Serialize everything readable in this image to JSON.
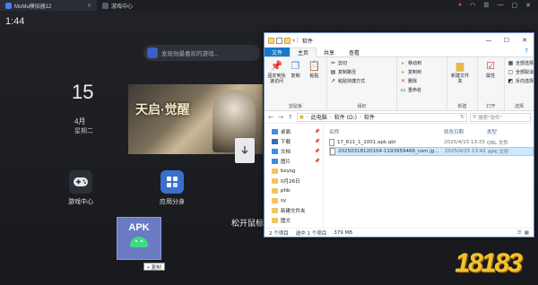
{
  "emulator": {
    "tabs": [
      {
        "label": "MuMu模拟器12"
      },
      {
        "label": "游戏中心"
      }
    ],
    "right_icons": [
      "notification-dot-icon",
      "wifi-icon",
      "menu-icon",
      "minimize-icon",
      "maximize-icon",
      "close-icon"
    ]
  },
  "android": {
    "clock": "1:44",
    "search_pill": "发现你最喜欢的游戏...",
    "date_day": "15",
    "date_month": "4月",
    "date_weekday": "星期二",
    "banner_title": "天启·觉醒",
    "apps": [
      {
        "label": "游戏中心",
        "icon": "gamepad-icon"
      },
      {
        "label": "应用分身",
        "icon": "app-split-icon"
      },
      {
        "label": "松开鼠标",
        "icon": "download-file-icon"
      }
    ],
    "apk_label": "APK",
    "copy_tip": "+ 复制"
  },
  "explorer": {
    "title": "软件",
    "ribbon_tabs": [
      "文件",
      "主页",
      "共享",
      "查看"
    ],
    "groups": {
      "clipboard": {
        "name": "剪贴板",
        "pin": "固定到快速访问",
        "copy": "复制",
        "paste": "粘贴",
        "cut": "剪切",
        "copy_path": "复制路径",
        "paste_shortcut": "粘贴快捷方式"
      },
      "organize": {
        "name": "组织",
        "move_to": "移动到",
        "delete": "删除",
        "copy_to": "复制到",
        "rename": "重命名"
      },
      "new": {
        "name": "新建",
        "new_folder": "新建文件夹"
      },
      "open": {
        "name": "打开",
        "properties": "属性"
      },
      "select": {
        "name": "选择",
        "select_all": "全部选择",
        "select_none": "全部取消",
        "invert": "反向选择"
      }
    },
    "address": [
      "此电脑",
      "软件 (D:)",
      "软件"
    ],
    "search_placeholder": "搜索\"软件\"",
    "nav_items": [
      {
        "label": "桌面",
        "type": "blue",
        "pinned": true
      },
      {
        "label": "下载",
        "type": "dl",
        "pinned": true
      },
      {
        "label": "文档",
        "type": "blue",
        "pinned": true
      },
      {
        "label": "图片",
        "type": "blue",
        "pinned": true
      },
      {
        "label": "bxysg",
        "type": "folder",
        "pinned": false
      },
      {
        "label": "0月26日",
        "type": "folder",
        "pinned": false
      },
      {
        "label": "phb",
        "type": "folder",
        "pinned": false
      },
      {
        "label": "sy",
        "type": "folder",
        "pinned": false
      },
      {
        "label": "新建文件夹",
        "type": "folder",
        "pinned": false
      },
      {
        "label": "图文",
        "type": "folder",
        "pinned": false
      }
    ],
    "columns": [
      "名称",
      "修改日期",
      "类型"
    ],
    "files": [
      {
        "name": "17_611_1_1001.apk.qbl",
        "date": "2025/4/15 13:33",
        "type": "QBL 文件",
        "selected": false
      },
      {
        "name": "20250318120104-1193959466_com.jg...",
        "date": "2025/4/15 13:42",
        "type": "APK 文件",
        "selected": true
      }
    ],
    "status": {
      "count": "2 个项目",
      "selected": "选中 1 个项目",
      "size": "379 MB"
    }
  },
  "watermark": "18183"
}
